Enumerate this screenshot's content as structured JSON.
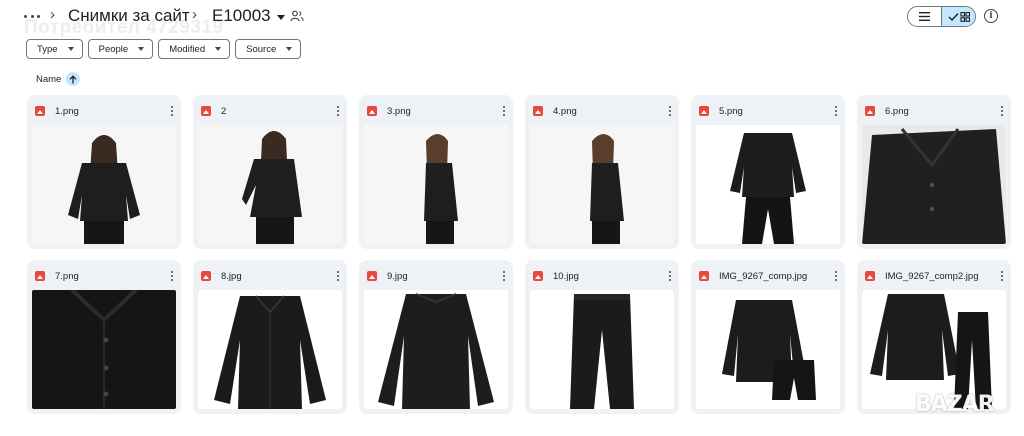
{
  "breadcrumb": {
    "root": "Снимки за сайт",
    "current": "E10003"
  },
  "watermark_text": "Потребител 4729319",
  "filters": [
    "Type",
    "People",
    "Modified",
    "Source"
  ],
  "sort": {
    "label": "Name",
    "direction": "ascending"
  },
  "view": {
    "mode": "grid"
  },
  "files": [
    {
      "name": "1.png",
      "kind": "photo-front"
    },
    {
      "name": "2",
      "kind": "photo-pose"
    },
    {
      "name": "3.png",
      "kind": "photo-side"
    },
    {
      "name": "4.png",
      "kind": "photo-side"
    },
    {
      "name": "5.png",
      "kind": "photo-back"
    },
    {
      "name": "6.png",
      "kind": "photo-closeup"
    },
    {
      "name": "7.png",
      "kind": "fabric-closeup"
    },
    {
      "name": "8.jpg",
      "kind": "shirt-front"
    },
    {
      "name": "9.jpg",
      "kind": "shirt-back"
    },
    {
      "name": "10.jpg",
      "kind": "trousers"
    },
    {
      "name": "IMG_9267_comp.jpg",
      "kind": "set-shorts"
    },
    {
      "name": "IMG_9267_comp2.jpg",
      "kind": "set-trousers"
    }
  ],
  "brand_logo": "BAZAR",
  "colors": {
    "accent": "#c2e7ff",
    "file_icon": "#e8483f",
    "card_bg": "#eef1f6"
  }
}
